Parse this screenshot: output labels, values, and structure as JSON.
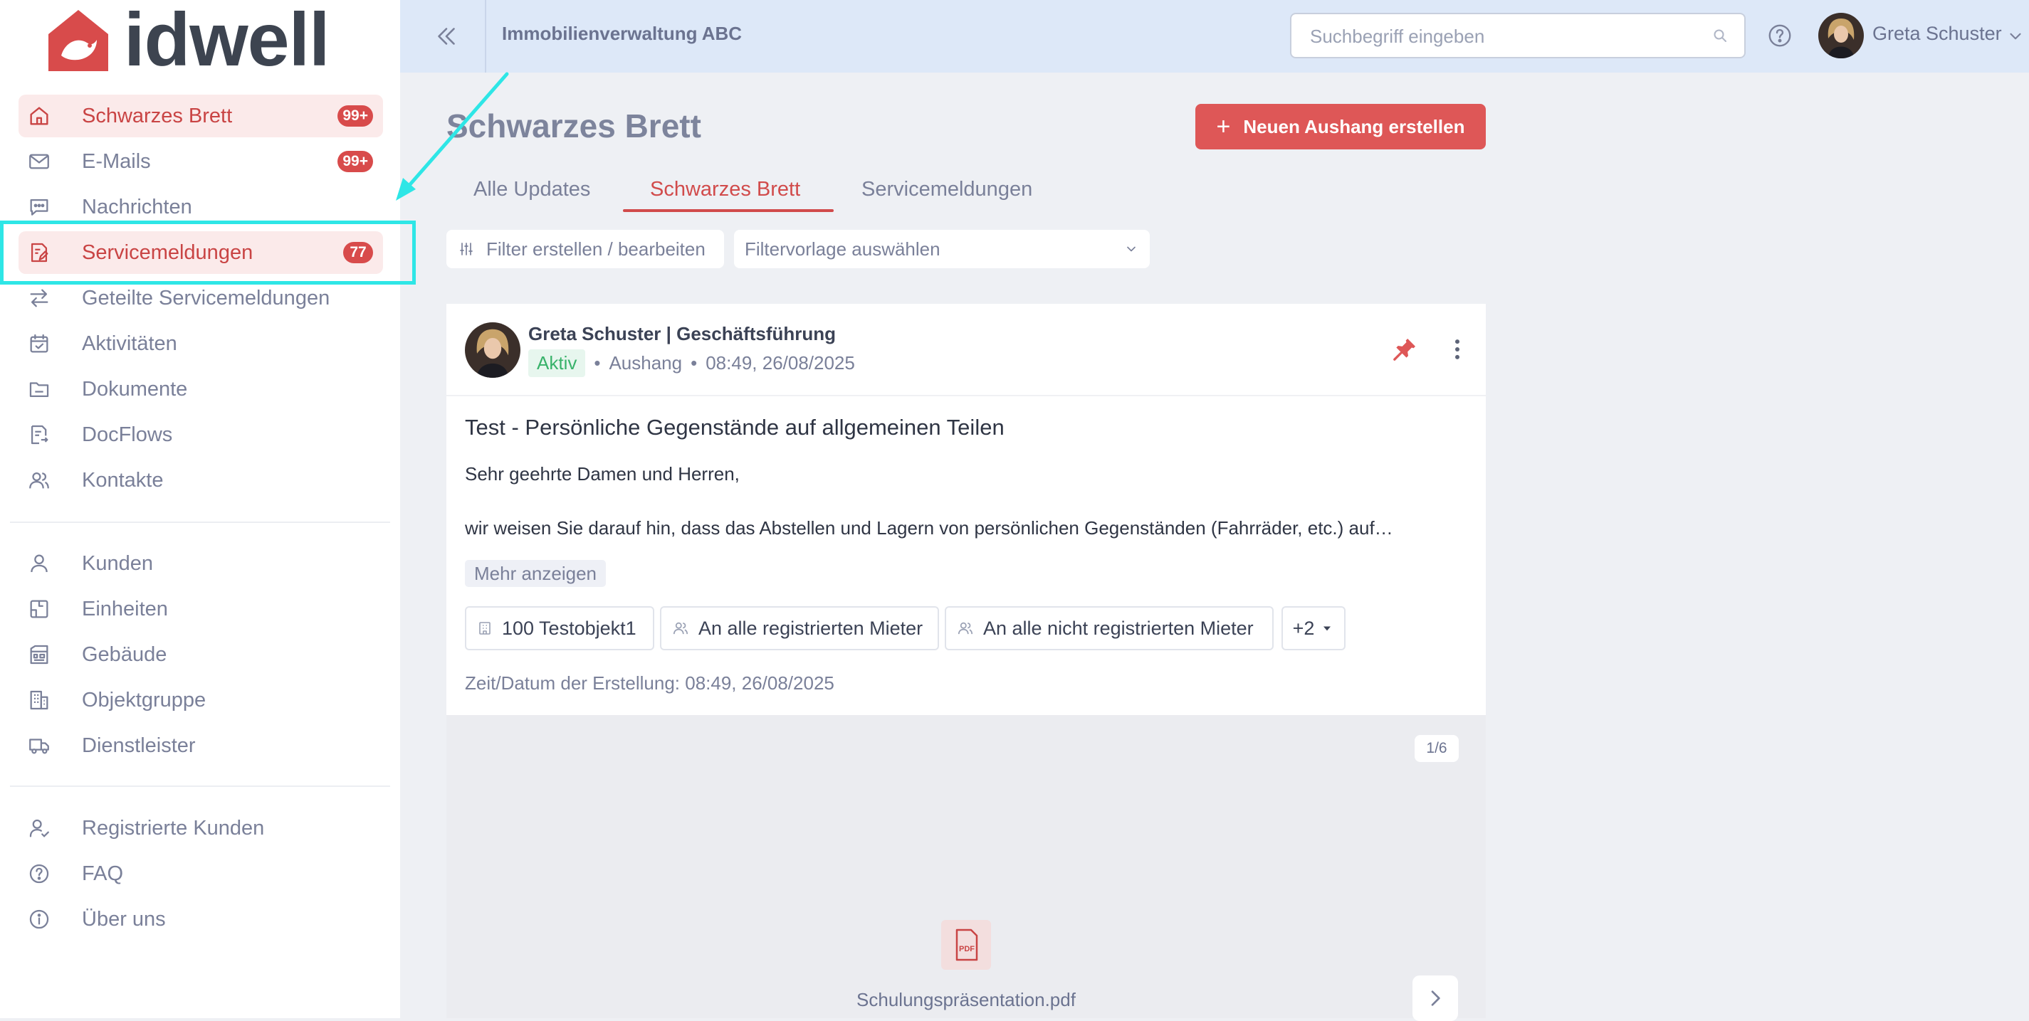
{
  "brand": {
    "logo_text": "idwell",
    "accent_color": "#de5757",
    "annotation_color": "#2ee6e6"
  },
  "sidebar": {
    "items": [
      {
        "label": "Schwarzes Brett",
        "badge": "99+",
        "icon": "home-icon",
        "active": true
      },
      {
        "label": "E-Mails",
        "badge": "99+",
        "icon": "mail-icon"
      },
      {
        "label": "Nachrichten",
        "icon": "chat-icon"
      },
      {
        "label": "Servicemeldungen",
        "badge": "77",
        "icon": "service-icon",
        "active": true
      },
      {
        "label": "Geteilte Servicemeldungen",
        "icon": "share-arrows-icon"
      },
      {
        "label": "Aktivitäten",
        "icon": "calendar-check-icon"
      },
      {
        "label": "Dokumente",
        "icon": "folder-icon"
      },
      {
        "label": "DocFlows",
        "icon": "docflow-icon"
      },
      {
        "label": "Kontakte",
        "icon": "contacts-icon"
      },
      {
        "label": "Kunden",
        "icon": "user-icon"
      },
      {
        "label": "Einheiten",
        "icon": "unit-icon"
      },
      {
        "label": "Gebäude",
        "icon": "building-icon"
      },
      {
        "label": "Objektgruppe",
        "icon": "building-group-icon"
      },
      {
        "label": "Dienstleister",
        "icon": "truck-icon"
      },
      {
        "label": "Registrierte Kunden",
        "icon": "user-check-icon"
      },
      {
        "label": "FAQ",
        "icon": "help-circle-icon"
      },
      {
        "label": "Über uns",
        "icon": "info-icon"
      }
    ]
  },
  "topbar": {
    "org_name": "Immobilienverwaltung ABC",
    "search_placeholder": "Suchbegriff eingeben",
    "user_name": "Greta Schuster"
  },
  "page": {
    "title": "Schwarzes Brett",
    "create_button": "Neuen Aushang erstellen",
    "tabs": [
      "Alle Updates",
      "Schwarzes Brett",
      "Servicemeldungen"
    ],
    "active_tab": "Schwarzes Brett",
    "filter_button": "Filter erstellen / bearbeiten",
    "filter_template": "Filtervorlage auswählen"
  },
  "post": {
    "author": "Greta Schuster | Geschäftsführung",
    "status": "Aktiv",
    "type": "Aushang",
    "timestamp": "08:49, 26/08/2025",
    "title": "Test - Persönliche Gegenstände auf allgemeinen Teilen",
    "greeting": "Sehr geehrte Damen und Herren,",
    "body": "wir weisen Sie darauf hin, dass das Abstellen und Lagern von persönlichen Gegenständen (Fahrräder, etc.) auf…",
    "more_label": "Mehr anzeigen",
    "chips": [
      "100 Testobjekt1",
      "An alle registrierten Mieter",
      "An alle nicht registrierten Mieter"
    ],
    "chips_more": "+2",
    "created_label": "Zeit/Datum der Erstellung: 08:49, 26/08/2025",
    "attachment": {
      "counter": "1/6",
      "file_name": "Schulungspräsentation.pdf",
      "file_type": "PDF"
    }
  }
}
